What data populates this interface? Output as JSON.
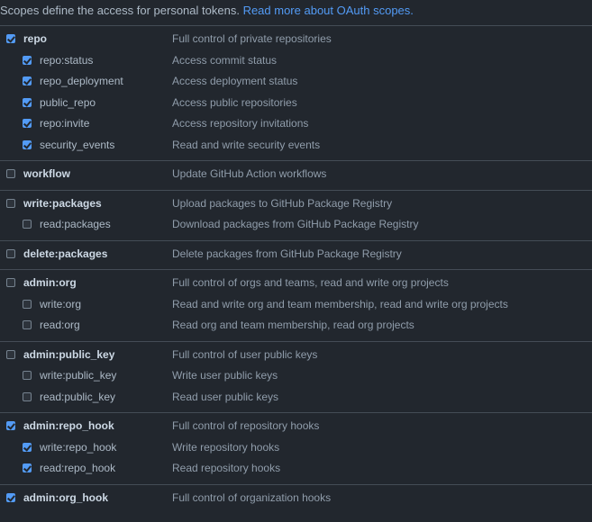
{
  "intro": {
    "text": "Scopes define the access for personal tokens.",
    "link": "Read more about OAuth scopes."
  },
  "groups": [
    {
      "name": "repo",
      "desc": "Full control of private repositories",
      "checked": true,
      "children": [
        {
          "name": "repo:status",
          "desc": "Access commit status",
          "checked": true
        },
        {
          "name": "repo_deployment",
          "desc": "Access deployment status",
          "checked": true
        },
        {
          "name": "public_repo",
          "desc": "Access public repositories",
          "checked": true
        },
        {
          "name": "repo:invite",
          "desc": "Access repository invitations",
          "checked": true
        },
        {
          "name": "security_events",
          "desc": "Read and write security events",
          "checked": true
        }
      ]
    },
    {
      "name": "workflow",
      "desc": "Update GitHub Action workflows",
      "checked": false,
      "children": []
    },
    {
      "name": "write:packages",
      "desc": "Upload packages to GitHub Package Registry",
      "checked": false,
      "children": [
        {
          "name": "read:packages",
          "desc": "Download packages from GitHub Package Registry",
          "checked": false
        }
      ]
    },
    {
      "name": "delete:packages",
      "desc": "Delete packages from GitHub Package Registry",
      "checked": false,
      "children": []
    },
    {
      "name": "admin:org",
      "desc": "Full control of orgs and teams, read and write org projects",
      "checked": false,
      "children": [
        {
          "name": "write:org",
          "desc": "Read and write org and team membership, read and write org projects",
          "checked": false
        },
        {
          "name": "read:org",
          "desc": "Read org and team membership, read org projects",
          "checked": false
        }
      ]
    },
    {
      "name": "admin:public_key",
      "desc": "Full control of user public keys",
      "checked": false,
      "children": [
        {
          "name": "write:public_key",
          "desc": "Write user public keys",
          "checked": false
        },
        {
          "name": "read:public_key",
          "desc": "Read user public keys",
          "checked": false
        }
      ]
    },
    {
      "name": "admin:repo_hook",
      "desc": "Full control of repository hooks",
      "checked": true,
      "children": [
        {
          "name": "write:repo_hook",
          "desc": "Write repository hooks",
          "checked": true
        },
        {
          "name": "read:repo_hook",
          "desc": "Read repository hooks",
          "checked": true
        }
      ]
    },
    {
      "name": "admin:org_hook",
      "desc": "Full control of organization hooks",
      "checked": true,
      "children": []
    }
  ]
}
